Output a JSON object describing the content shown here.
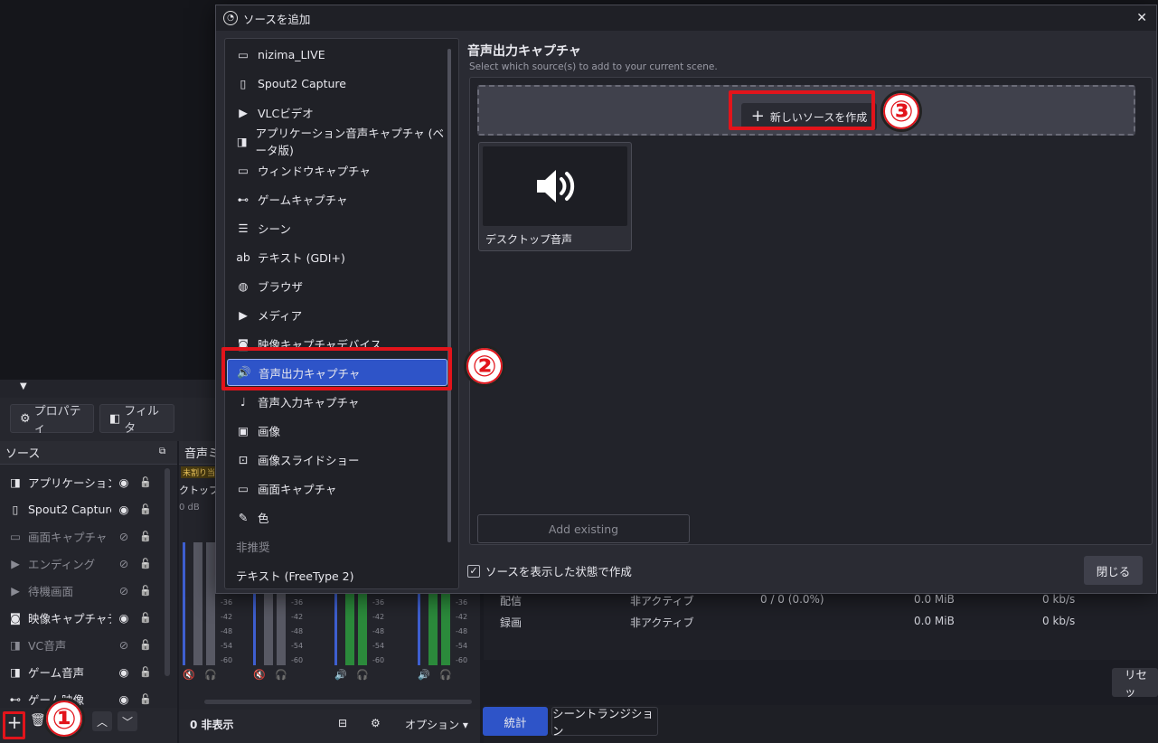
{
  "dialog": {
    "title": "ソースを追加",
    "close_glyph": "✕",
    "source_types": [
      {
        "label": "nizima_LIVE",
        "icon": "window-icon"
      },
      {
        "label": "Spout2 Capture",
        "icon": "file-icon"
      },
      {
        "label": "VLCビデオ",
        "icon": "play-icon"
      },
      {
        "label": "アプリケーション音声キャプチャ (ベータ版)",
        "icon": "app-audio-icon"
      },
      {
        "label": "ウィンドウキャプチャ",
        "icon": "window-icon"
      },
      {
        "label": "ゲームキャプチャ",
        "icon": "gamepad-icon"
      },
      {
        "label": "シーン",
        "icon": "list-icon"
      },
      {
        "label": "テキスト (GDI+)",
        "icon": "text-icon"
      },
      {
        "label": "ブラウザ",
        "icon": "globe-icon"
      },
      {
        "label": "メディア",
        "icon": "play-icon"
      },
      {
        "label": "映像キャプチャデバイス",
        "icon": "camera-icon"
      },
      {
        "label": "音声出力キャプチャ",
        "icon": "speaker-icon"
      },
      {
        "label": "音声入力キャプチャ",
        "icon": "microphone-icon"
      },
      {
        "label": "画像",
        "icon": "image-icon"
      },
      {
        "label": "画像スライドショー",
        "icon": "slideshow-icon"
      },
      {
        "label": "画面キャプチャ",
        "icon": "monitor-icon"
      },
      {
        "label": "色",
        "icon": "brush-icon"
      }
    ],
    "deprecated_header": "非推奨",
    "deprecated_item": "テキスト (FreeType 2)",
    "selected_type": "音声出力キャプチャ",
    "right_title": "音声出力キャプチャ",
    "right_subtitle": "Select which source(s) to add to your current scene.",
    "new_source_label": "新しいソースを作成",
    "existing_source_name": "デスクトップ音声",
    "add_existing_label": "Add existing",
    "visible_checkbox_label": "ソースを表示した状態で作成",
    "close_label": "閉じる"
  },
  "annotations": {
    "step1": "①",
    "step2": "②",
    "step3": "③",
    "accent": "#e2141b"
  },
  "obs": {
    "properties_label": "プロパティ",
    "filters_label": "フィルタ",
    "sources_title": "ソース",
    "mixer_title": "音声ミ",
    "sources": [
      {
        "name": "アプリケーション音声",
        "icon": "app-audio-icon",
        "visible": true
      },
      {
        "name": "Spout2 Capture",
        "icon": "file-icon",
        "visible": true
      },
      {
        "name": "画面キャプチャ",
        "icon": "monitor-icon",
        "visible": false
      },
      {
        "name": "エンディング",
        "icon": "play-icon",
        "visible": false
      },
      {
        "name": "待機画面",
        "icon": "play-icon",
        "visible": false
      },
      {
        "name": "映像キャプチャデバイス",
        "icon": "camera-icon",
        "visible": true
      },
      {
        "name": "VC音声",
        "icon": "app-audio-icon",
        "visible": false
      },
      {
        "name": "ゲーム音声",
        "icon": "app-audio-icon",
        "visible": true
      },
      {
        "name": "ゲーム映像",
        "icon": "gamepad-icon",
        "visible": true
      }
    ],
    "mixer_badge": "未割り当",
    "mixer_track": "クトップ音",
    "mixer_db": "0 dB",
    "meter_ticks": [
      "-36",
      "-42",
      "-48",
      "-54",
      "-60"
    ],
    "hidden_count": "0 非表示",
    "options_label": "オプション",
    "stats": [
      {
        "label": "配信",
        "status": "非アクティブ",
        "frames": "0 / 0 (0.0%)",
        "size": "0.0 MiB",
        "rate": "0 kb/s"
      },
      {
        "label": "録画",
        "status": "非アクティブ",
        "frames": "",
        "size": "0.0 MiB",
        "rate": "0 kb/s"
      }
    ],
    "reset_label": "リセッ",
    "tab_stats": "統計",
    "tab_transition": "シーントランジション"
  }
}
